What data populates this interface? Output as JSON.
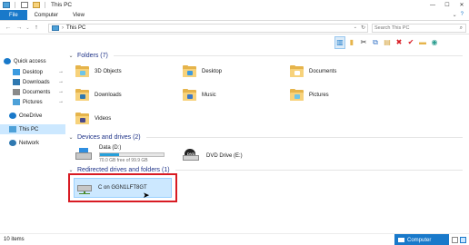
{
  "window": {
    "title": "This PC",
    "controls": {
      "minimize": "—",
      "maximize": "☐",
      "close": "✕"
    }
  },
  "ribbon": {
    "tabs": [
      "File",
      "Computer",
      "View"
    ],
    "right_icons": [
      "chevron-down-icon",
      "help-icon"
    ],
    "right_glyphs": {
      "chevron": "⌄",
      "help": "?"
    }
  },
  "nav": {
    "back": "←",
    "forward": "→",
    "recent": "⌄",
    "up": "↑"
  },
  "address": {
    "path": "This PC",
    "dropdown": "⌄",
    "refresh": "↻"
  },
  "search": {
    "placeholder": "Search This PC",
    "icon": "⌕"
  },
  "toolbar": {
    "buttons": [
      {
        "name": "layout-icon",
        "glyph": "▥",
        "color": "#1979ca"
      },
      {
        "name": "pin-to-quick-access-icon",
        "glyph": "▮",
        "color": "#e6b44b"
      },
      {
        "name": "cut-icon",
        "glyph": "✂",
        "color": "#333333"
      },
      {
        "name": "copy-icon",
        "glyph": "⧉",
        "color": "#3c78c8"
      },
      {
        "name": "paste-icon",
        "glyph": "▤",
        "color": "#d4a23a"
      },
      {
        "name": "delete-icon",
        "glyph": "✖",
        "color": "#d81b23"
      },
      {
        "name": "check-icon",
        "glyph": "✔",
        "color": "#d81b23"
      },
      {
        "name": "new-folder-icon",
        "glyph": "▬",
        "color": "#e6b44b"
      },
      {
        "name": "network-icon",
        "glyph": "◉",
        "color": "#2a9d8f"
      }
    ]
  },
  "sidebar": {
    "items": [
      {
        "label": "Quick access",
        "icon": "star-icon",
        "color": "#1979ca",
        "pinned": false
      },
      {
        "label": "Desktop",
        "icon": "desktop-icon",
        "color": "#3c9be0",
        "pinned": true
      },
      {
        "label": "Downloads",
        "icon": "download-icon",
        "color": "#2f78b0",
        "pinned": true
      },
      {
        "label": "Documents",
        "icon": "documents-icon",
        "color": "#8a8a8a",
        "pinned": true
      },
      {
        "label": "Pictures",
        "icon": "pictures-icon",
        "color": "#4ea1d8",
        "pinned": true
      },
      {
        "label": "OneDrive",
        "icon": "cloud-icon",
        "color": "#1979ca",
        "pinned": false
      },
      {
        "label": "This PC",
        "icon": "pc-icon",
        "color": "#4ea1d8",
        "pinned": false,
        "selected": true
      },
      {
        "label": "Network",
        "icon": "network-icon",
        "color": "#2f78b0",
        "pinned": false
      }
    ],
    "pin_glyph": "📌"
  },
  "groups": {
    "folders": {
      "header": "Folders (7)",
      "chevron": "⌄"
    },
    "drives": {
      "header": "Devices and drives (2)",
      "chevron": "⌄"
    },
    "redirected": {
      "header": "Redirected drives and folders (1)",
      "chevron": "⌄"
    }
  },
  "folders": [
    {
      "label": "3D Objects",
      "badge_color": "#6ec5e9"
    },
    {
      "label": "Desktop",
      "badge_color": "#3c9be0"
    },
    {
      "label": "Documents",
      "badge_color": "#ffffff"
    },
    {
      "label": "Downloads",
      "badge_color": "#2f78b0"
    },
    {
      "label": "Music",
      "badge_color": "#3c78c8"
    },
    {
      "label": "Pictures",
      "badge_color": "#6ec5e9"
    },
    {
      "label": "Videos",
      "badge_color": "#4a4a8a"
    }
  ],
  "drives": [
    {
      "label": "Data (D:)",
      "free_text": "70.0 GB free of 99.9 GB",
      "used_fraction": 0.3,
      "icon": "hard-drive-icon"
    },
    {
      "label": "DVD Drive (E:)",
      "icon": "dvd-drive-icon",
      "dvd_text": "DVD"
    }
  ],
  "redirected": [
    {
      "label": "C on GGN1LFT8GT",
      "icon": "network-drive-icon"
    }
  ],
  "cursor_glyph": "➤",
  "status": {
    "item_count": "10 items",
    "computer_label": "Computer"
  },
  "colors": {
    "accent": "#1979ca",
    "selection": "#cce8ff",
    "highlight_border": "#d81b23",
    "group_header": "#1e3287"
  }
}
